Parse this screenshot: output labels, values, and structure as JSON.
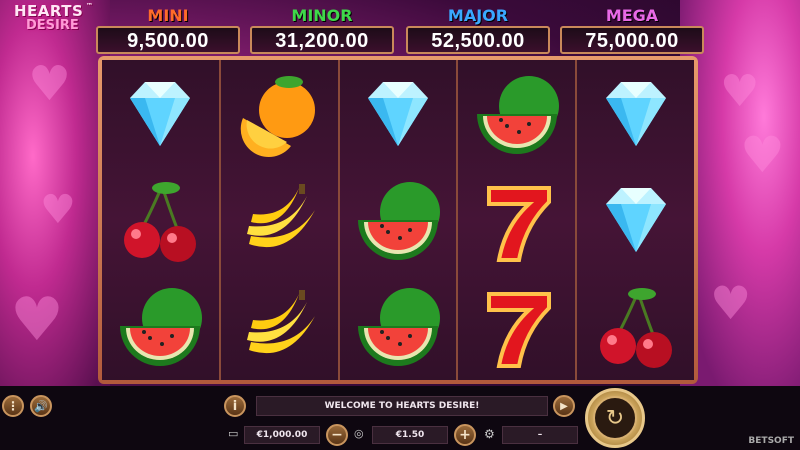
{
  "game": {
    "title_line1": "HEARTS",
    "title_line2": "DESIRE",
    "trademark": "™"
  },
  "jackpots": [
    {
      "name": "MINI",
      "value": "9,500.00",
      "color": "#ff6a2a"
    },
    {
      "name": "MINOR",
      "value": "31,200.00",
      "color": "#3fd84a"
    },
    {
      "name": "MAJOR",
      "value": "52,500.00",
      "color": "#3aa8ff"
    },
    {
      "name": "MEGA",
      "value": "75,000.00",
      "color": "#e86ae6"
    }
  ],
  "reels": [
    [
      "diamond",
      "cherry",
      "watermelon"
    ],
    [
      "orange",
      "banana",
      "banana"
    ],
    [
      "diamond",
      "watermelon",
      "watermelon"
    ],
    [
      "watermelon",
      "seven",
      "seven"
    ],
    [
      "diamond",
      "diamond",
      "cherry"
    ]
  ],
  "controls": {
    "message": "WELCOME TO HEARTS DESIRE!",
    "balance": "€1,000.00",
    "bet": "€1.50",
    "autoplay_value": "–",
    "menu_icon": "menu-dots-icon",
    "sound_icon": "speaker-icon",
    "info_icon": "info-icon",
    "play_icon": "play-icon",
    "spin_icon": "spin-arrows-icon",
    "wallet_icon": "wallet-icon",
    "coins_icon": "coins-icon",
    "minus_icon": "minus-icon",
    "plus_icon": "plus-icon",
    "autoplay_icon": "autoplay-icon"
  },
  "brand": "BETSOFT"
}
